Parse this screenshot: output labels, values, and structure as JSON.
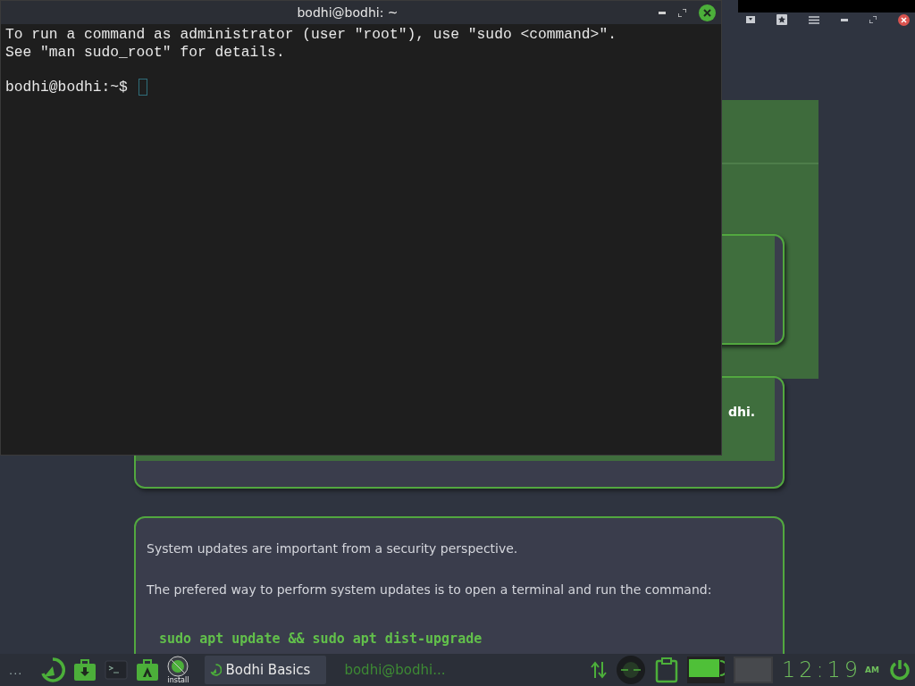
{
  "terminal": {
    "title": "bodhi@bodhi: ~",
    "lines": [
      "To run a command as administrator (user \"root\"), use \"sudo <command>\".",
      "See \"man sudo_root\" for details."
    ],
    "prompt": "bodhi@bodhi:~$ "
  },
  "background_window": {
    "partial_text": "dhi.",
    "paragraphs": [
      "System updates are important from a security perspective.",
      "The prefered way to perform system updates is to open a terminal and run the command:"
    ],
    "command": "sudo apt update && sudo apt dist-upgrade"
  },
  "taskbar": {
    "menu": "...",
    "launcher_label": "install",
    "tasks": [
      {
        "label": "Bodhi Basics",
        "selected": true
      },
      {
        "label": "bodhi@bodhi...",
        "selected": false
      }
    ],
    "clock": {
      "time": "12:19",
      "period": "AM"
    }
  }
}
